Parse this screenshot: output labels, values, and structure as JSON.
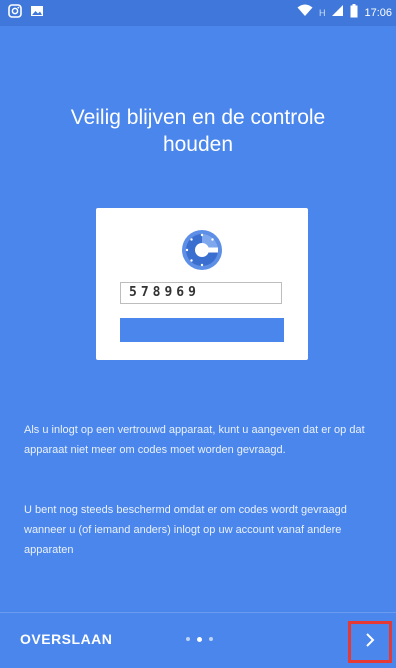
{
  "status_bar": {
    "time": "17:06",
    "network": "H"
  },
  "onboarding": {
    "title_line1": "Veilig blijven en de controle",
    "title_line2": "houden",
    "sample_code": "578969",
    "paragraph1": "Als u inlogt op een vertrouwd apparaat, kunt u aangeven dat er op dat apparaat niet meer om codes moet worden gevraagd.",
    "paragraph2": "U bent nog steeds beschermd omdat er om codes wordt gevraagd wanneer u (of iemand anders) inlogt op uw account vanaf andere apparaten",
    "skip_label": "OVERSLAAN",
    "page_indicator": {
      "total": 3,
      "current": 2
    }
  },
  "icons": [
    "instagram-icon",
    "image-icon",
    "wifi-icon",
    "signal-icon",
    "battery-icon",
    "authenticator-logo",
    "chevron-right-icon"
  ],
  "colors": {
    "background": "#4A86EB",
    "highlight": "#E53935"
  }
}
